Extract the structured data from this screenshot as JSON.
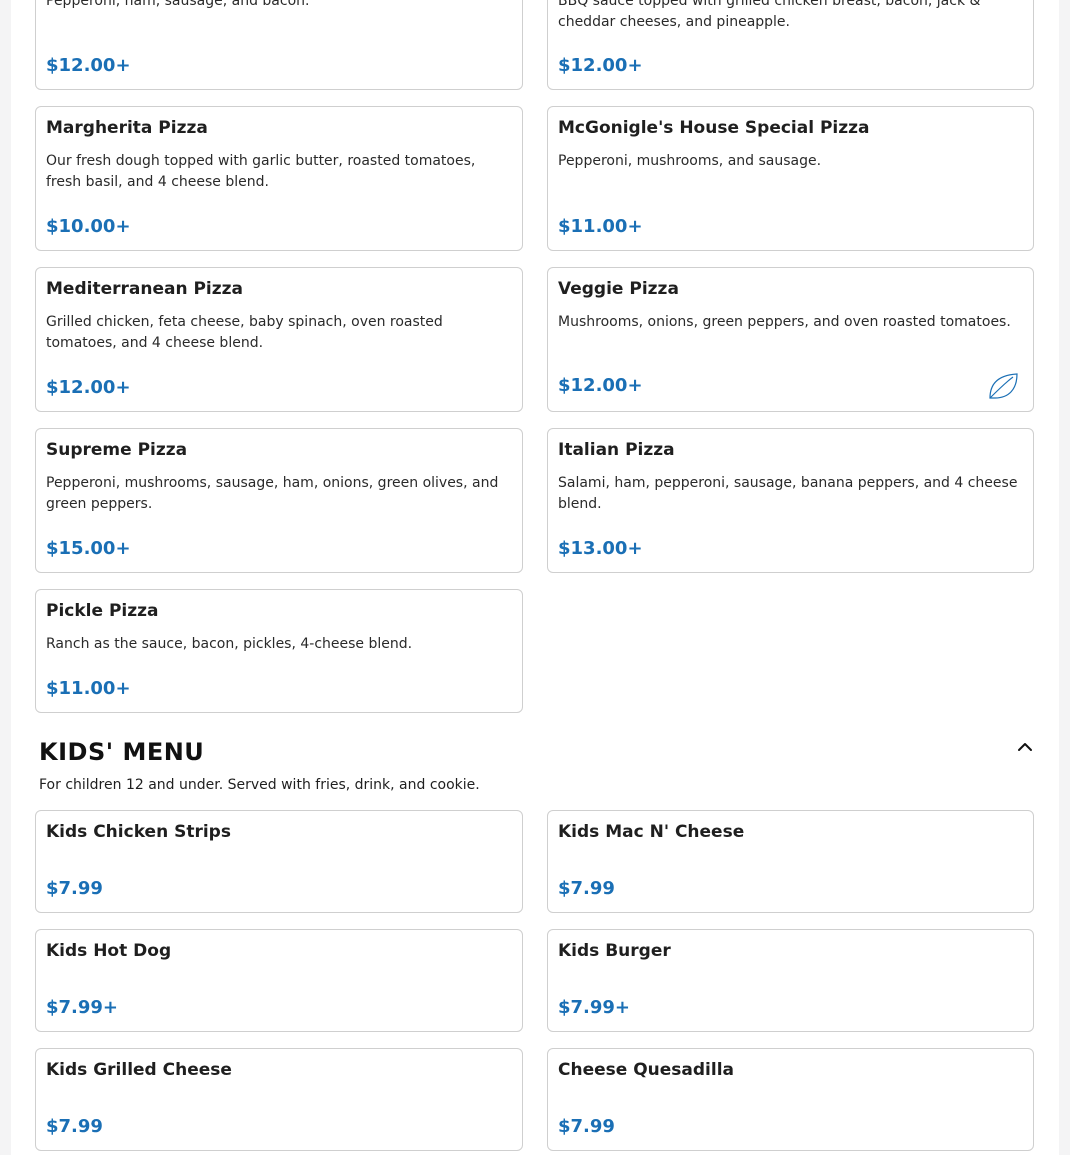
{
  "pizza": [
    {
      "desc": "Pepperoni, ham, sausage, and bacon.",
      "price": "$12.00+"
    },
    {
      "desc": "BBQ sauce topped with grilled chicken breast, bacon, jack & cheddar cheeses, and pineapple.",
      "price": "$12.00+"
    },
    {
      "name": "Margherita Pizza",
      "desc": "Our fresh dough topped with garlic butter, roasted tomatoes, fresh basil, and 4 cheese blend.",
      "price": "$10.00+"
    },
    {
      "name": "McGonigle's House Special Pizza",
      "desc": "Pepperoni, mushrooms, and sausage.",
      "price": "$11.00+"
    },
    {
      "name": "Mediterranean Pizza",
      "desc": "Grilled chicken, feta cheese, baby spinach, oven roasted tomatoes, and 4 cheese blend.",
      "price": "$12.00+"
    },
    {
      "name": "Veggie Pizza",
      "desc": "Mushrooms, onions, green peppers, and oven roasted tomatoes.",
      "price": "$12.00+",
      "icon": "leaf-icon"
    },
    {
      "name": "Supreme Pizza",
      "desc": "Pepperoni, mushrooms, sausage, ham, onions, green olives, and green peppers.",
      "price": "$15.00+"
    },
    {
      "name": "Italian Pizza",
      "desc": "Salami, ham, pepperoni, sausage, banana peppers, and 4 cheese blend.",
      "price": "$13.00+"
    },
    {
      "name": "Pickle Pizza",
      "desc": "Ranch as the sauce, bacon, pickles, 4-cheese blend.",
      "price": "$11.00+"
    }
  ],
  "kids": {
    "title": "KIDS' MENU",
    "note": "For children 12 and under. Served with fries, drink, and cookie.",
    "collapse_icon": "chevron-up-icon",
    "items": [
      {
        "name": "Kids Chicken Strips",
        "price": "$7.99"
      },
      {
        "name": "Kids Mac N' Cheese",
        "price": "$7.99"
      },
      {
        "name": "Kids Hot Dog",
        "price": "$7.99+"
      },
      {
        "name": "Kids Burger",
        "price": "$7.99+"
      },
      {
        "name": "Kids Grilled Cheese",
        "price": "$7.99"
      },
      {
        "name": "Cheese Quesadilla",
        "price": "$7.99"
      }
    ]
  },
  "colors": {
    "price": "#1a6fb5",
    "border": "#cfcfcf"
  }
}
